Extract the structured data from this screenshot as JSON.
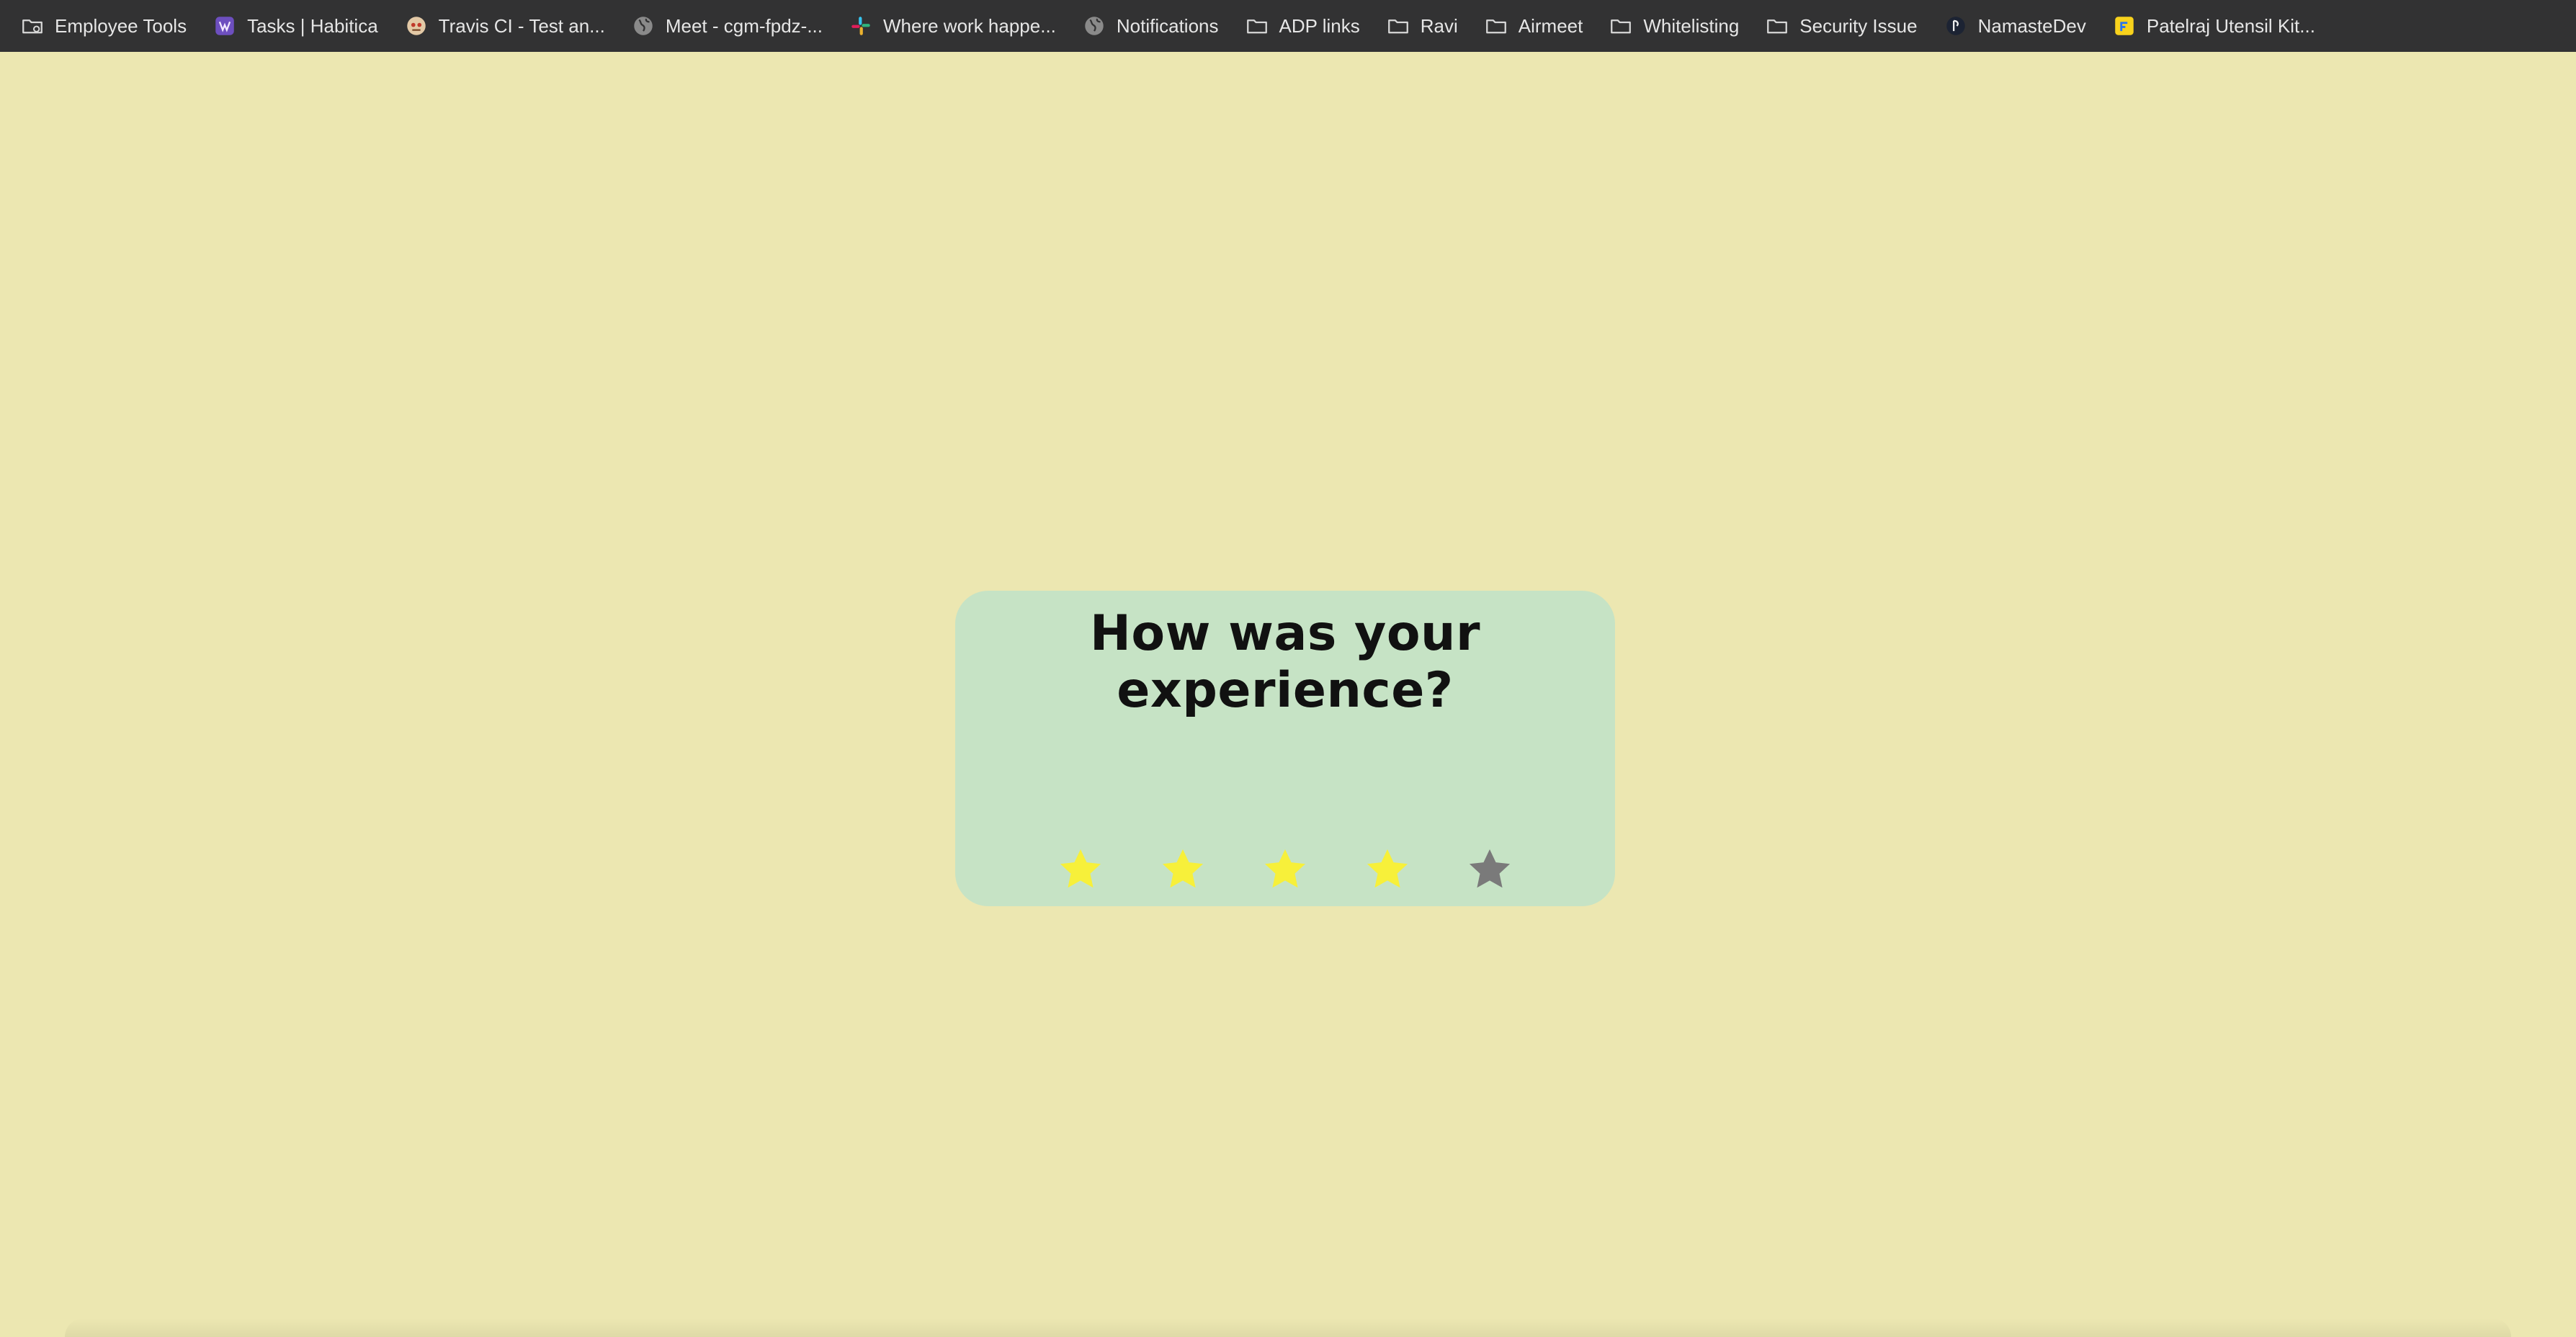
{
  "bookmarks": [
    {
      "label": "Employee Tools",
      "icon": "folder-settings-icon"
    },
    {
      "label": "Tasks | Habitica",
      "icon": "habitica-icon"
    },
    {
      "label": "Travis CI - Test an...",
      "icon": "travis-ci-icon"
    },
    {
      "label": "Meet - cgm-fpdz-...",
      "icon": "globe-icon"
    },
    {
      "label": "Where work happe...",
      "icon": "slack-icon"
    },
    {
      "label": "Notifications",
      "icon": "globe-icon"
    },
    {
      "label": "ADP links",
      "icon": "folder-icon"
    },
    {
      "label": "Ravi",
      "icon": "folder-icon"
    },
    {
      "label": "Airmeet",
      "icon": "folder-icon"
    },
    {
      "label": "Whitelisting",
      "icon": "folder-icon"
    },
    {
      "label": "Security Issue",
      "icon": "folder-icon"
    },
    {
      "label": "NamasteDev",
      "icon": "namastedev-icon"
    },
    {
      "label": "Patelraj Utensil Kit...",
      "icon": "flipkart-icon"
    }
  ],
  "rating_card": {
    "title": "How was your experience?",
    "max_stars": 5,
    "selected_stars": 4
  },
  "colors": {
    "page_background": "#ece7b1",
    "card_background": "#c6e3c5",
    "star_active": "#f7f03a",
    "star_inactive": "#7a7a7a",
    "bookmarks_bar": "#323233"
  }
}
